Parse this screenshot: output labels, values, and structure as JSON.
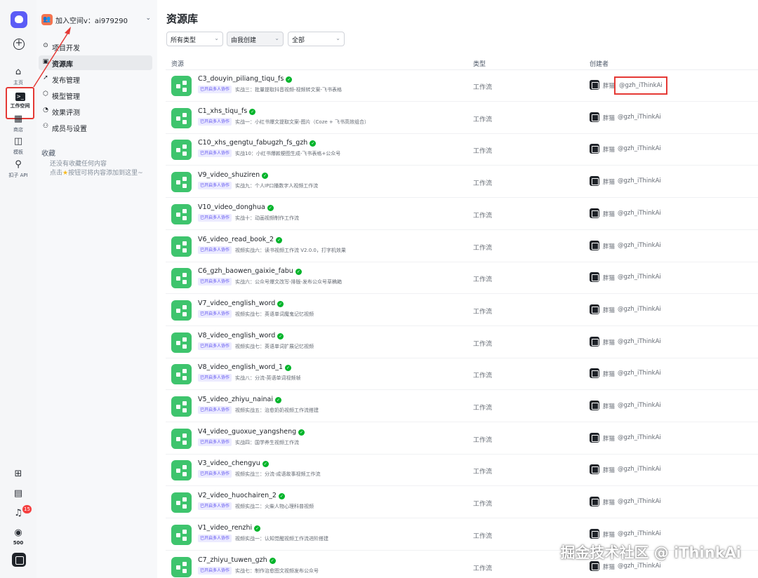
{
  "rail": {
    "items": [
      {
        "label": "主页",
        "icon": "home-icon"
      },
      {
        "label": "工作空间",
        "icon": "workspace-icon"
      },
      {
        "label": "商店",
        "icon": "store-icon"
      },
      {
        "label": "模板",
        "icon": "template-icon"
      },
      {
        "label": "扣子 API",
        "icon": "api-icon"
      }
    ],
    "notification_count": "15",
    "credits": "500"
  },
  "sidebar": {
    "space_name": "加入空间v：ai979290",
    "nav": [
      {
        "label": "项目开发",
        "icon": "code-icon"
      },
      {
        "label": "资源库",
        "icon": "library-icon"
      },
      {
        "label": "发布管理",
        "icon": "rocket-icon"
      },
      {
        "label": "模型管理",
        "icon": "model-icon"
      },
      {
        "label": "效果评测",
        "icon": "gauge-icon"
      },
      {
        "label": "成员与设置",
        "icon": "members-icon"
      }
    ],
    "favorites_title": "收藏",
    "favorites_empty_1": "还没有收藏任何内容",
    "favorites_empty_2a": "点击",
    "favorites_empty_2b": "按钮可将内容添加到这里~"
  },
  "main": {
    "title": "资源库",
    "filters": [
      "所有类型",
      "由我创建",
      "全部"
    ],
    "columns": [
      "资源",
      "类型",
      "创建者"
    ],
    "creator_name": "胖猫",
    "creator_handle": "@gzh_iThinkAi",
    "rows": [
      {
        "name": "C3_douyin_piliang_tiqu_fs",
        "tag": "已开启多人协作",
        "desc": "实战三：批量提取抖音视频-视频转文案-飞书表格",
        "type": "工作流"
      },
      {
        "name": "C1_xhs_tiqu_fs",
        "tag": "已开启多人协作",
        "desc": "实战一：小红书爆文提取文案-图片（Coze + 飞书高效组合）",
        "type": "工作流"
      },
      {
        "name": "C10_xhs_gengtu_fabugzh_fs_gzh",
        "tag": "已开启多人协作",
        "desc": "实战10：小红书爆款梗图生成-飞书表格+公众号",
        "type": "工作流"
      },
      {
        "name": "V9_video_shuziren",
        "tag": "已开启多人协作",
        "desc": "实战九：个人IP口播数字人视频工作流",
        "type": "工作流"
      },
      {
        "name": "V10_video_donghua",
        "tag": "已开启多人协作",
        "desc": "实战十：动画视频制作工作流",
        "type": "工作流"
      },
      {
        "name": "V6_video_read_book_2",
        "tag": "已开启多人协作",
        "desc": "视频实战六：读书视频工作流 V2.0.0，打字机效果",
        "type": "工作流"
      },
      {
        "name": "C6_gzh_baowen_gaixie_fabu",
        "tag": "已开启多人协作",
        "desc": "实战六：公众号爆文改写-排版-发布公众号草稿箱",
        "type": "工作流"
      },
      {
        "name": "V7_video_english_word",
        "tag": "已开启多人协作",
        "desc": "视频实战七：英语单词魔鬼记忆视频",
        "type": "工作流"
      },
      {
        "name": "V8_video_english_word",
        "tag": "已开启多人协作",
        "desc": "视频实战七：英语单词扩展记忆视频",
        "type": "工作流"
      },
      {
        "name": "V8_video_english_word_1",
        "tag": "已开启多人协作",
        "desc": "实战八：分流-英语单词视频帧",
        "type": "工作流"
      },
      {
        "name": "V5_video_zhiyu_nainai",
        "tag": "已开启多人协作",
        "desc": "视频实战五：治愈奶奶视频工作流搭建",
        "type": "工作流"
      },
      {
        "name": "V4_video_guoxue_yangsheng",
        "tag": "已开启多人协作",
        "desc": "实战四：国学养生视频工作流",
        "type": "工作流"
      },
      {
        "name": "V3_video_chengyu",
        "tag": "已开启多人协作",
        "desc": "视频实战三：分流-成语故事视频工作流",
        "type": "工作流"
      },
      {
        "name": "V2_video_huochairen_2",
        "tag": "已开启多人协作",
        "desc": "视频实战二：火柴人物心理科普视频",
        "type": "工作流"
      },
      {
        "name": "V1_video_renzhi",
        "tag": "已开启多人协作",
        "desc": "视频实战一：认知觉醒视频工作流进阶搭建",
        "type": "工作流"
      },
      {
        "name": "C7_zhiyu_tuwen_gzh",
        "tag": "已开启多人协作",
        "desc": "实战七：制作治愈图文视频发布公众号",
        "type": "工作流"
      }
    ]
  },
  "watermark": "掘金技术社区 @ iThinkAi",
  "colors": {
    "accent": "#5b5cf6",
    "workflow_icon": "#3ec46d",
    "highlight": "#e53935",
    "badge": "#f53f3f"
  }
}
